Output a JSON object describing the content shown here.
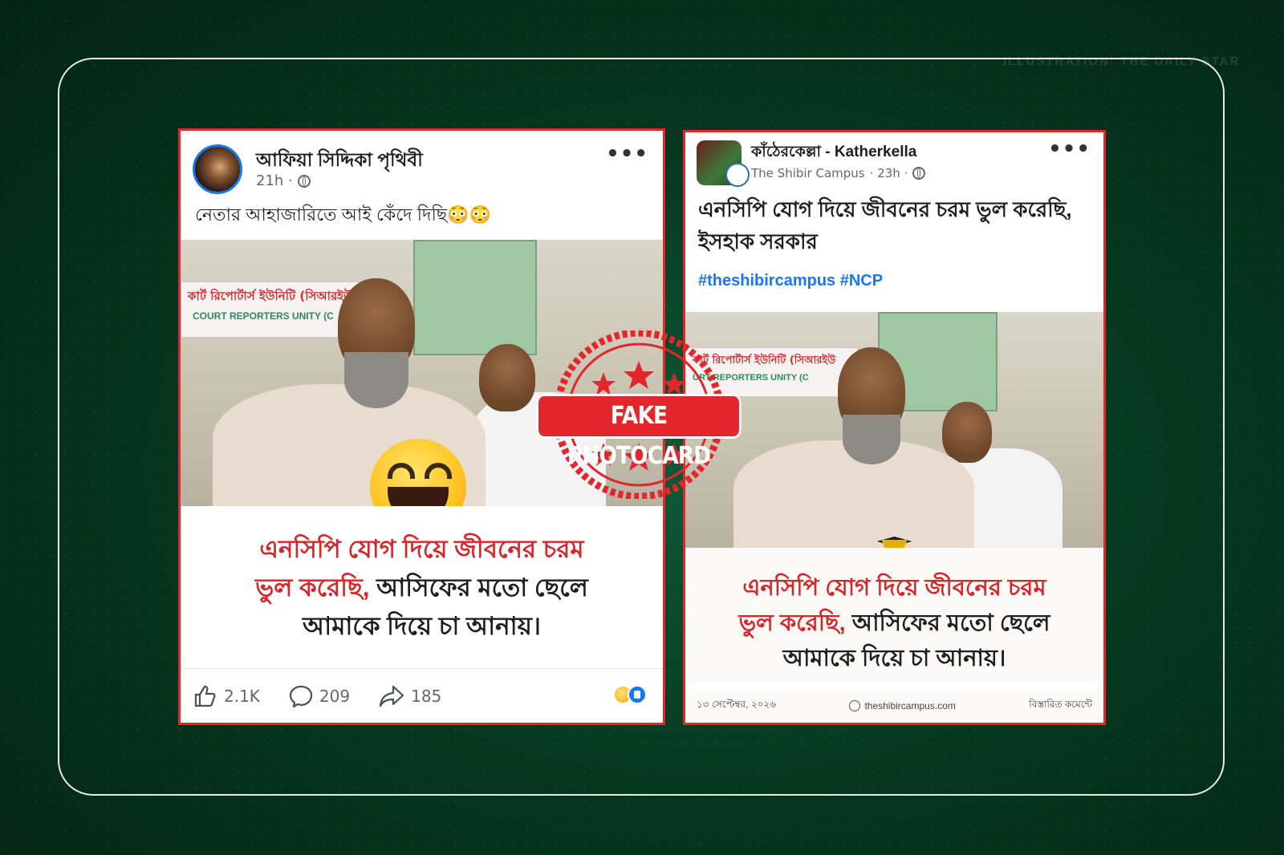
{
  "credit": "ILLUSTRATION: THE DAILY STAR",
  "post_left": {
    "author": "আফিয়া সিদ্দিকা পৃথিবী",
    "time": "21h ·",
    "caption": "নেতার আহাজারিতে আই কেঁদে দিছি😳😳",
    "banner_bn": "কার্ট রিপোর্টার্স ইউনিটি (সিআরইউ",
    "banner_en": "COURT REPORTERS UNITY (C",
    "overlay_red_1": "এনসিপি যোগ দিয়ে জীবনের চরম",
    "overlay_red_2": "ভুল করেছি,",
    "overlay_black_2": " আসিফের মতো ছেলে",
    "overlay_black_3": "আমাকে দিয়ে চা আনায়।",
    "likes": "2.1K",
    "comments": "209",
    "shares": "185"
  },
  "post_right": {
    "author": "কাঁঠেরকেল্লা - Katherkella",
    "subpage": "The Shibir Campus",
    "time": "· 23h ·",
    "headline": "এনসিপি যোগ দিয়ে জীবনের চরম ভুল করেছি, ইসহাক সরকার",
    "hashtags": "#theshibircampus #NCP",
    "banner_bn": "কার্ট রিপোর্টার্স ইউনিটি (সিআরইউ",
    "banner_en": "URT REPORTERS UNITY (C",
    "overlay_red_1": "এনসিপি যোগ দিয়ে জীবনের চরম",
    "overlay_red_2": "ভুল করেছি,",
    "overlay_black_2": " আসিফের মতো ছেলে",
    "overlay_black_3": "আমাকে দিয়ে চা আনায়।",
    "footer_date": "১৩ সেপ্টেম্বর, ২০২৬",
    "footer_site": "theshibircampus.com",
    "footer_more": "বিস্তারিত কমেন্টে"
  },
  "stamp": {
    "label": "FAKE PHOTOCARD",
    "color": "#e3262b"
  },
  "colors": {
    "accent_red": "#e3262b",
    "link_blue": "#1877f2",
    "background": "#06391f"
  }
}
